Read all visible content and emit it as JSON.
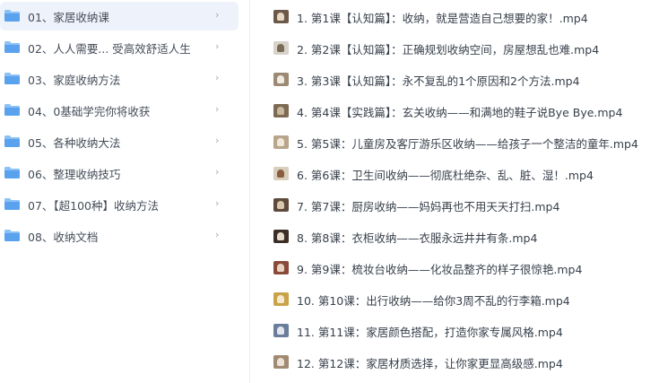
{
  "folders": [
    {
      "label": "01、家居收纳课",
      "active": true
    },
    {
      "label": "02、人人需要... 受高效舒适人生",
      "active": false
    },
    {
      "label": "03、家庭收纳方法",
      "active": false
    },
    {
      "label": "04、0基础学完你将收获",
      "active": false
    },
    {
      "label": "05、各种收纳大法",
      "active": false
    },
    {
      "label": "06、整理收纳技巧",
      "active": false
    },
    {
      "label": "07、【超100种】收纳方法",
      "active": false
    },
    {
      "label": "08、收纳文档",
      "active": false
    }
  ],
  "chevron_glyph": "›",
  "files": [
    {
      "label": "1. 第1课【认知篇】：收纳，就是营造自己想要的家！.mp4"
    },
    {
      "label": "2. 第2课【认知篇】：正确规划收纳空间，房屋想乱也难.mp4"
    },
    {
      "label": "3. 第3课【认知篇】：永不复乱的1个原因和2个方法.mp4"
    },
    {
      "label": "4. 第4课【实践篇】：玄关收纳——和满地的鞋子说Bye Bye.mp4"
    },
    {
      "label": "5. 第5课：儿童房及客厅游乐区收纳——给孩子一个整洁的童年.mp4"
    },
    {
      "label": "6. 第6课：卫生间收纳——彻底杜绝杂、乱、脏、湿！.mp4"
    },
    {
      "label": "7. 第7课：厨房收纳——妈妈再也不用天天打扫.mp4"
    },
    {
      "label": "8. 第8课：衣柜收纳——衣服永远井井有条.mp4"
    },
    {
      "label": "9. 第9课：梳妆台收纳——化妆品整齐的样子很惊艳.mp4"
    },
    {
      "label": "10. 第10课：出行收纳——给你3周不乱的行李箱.mp4"
    },
    {
      "label": "11. 第11课：家居颜色搭配，打造你家专属风格.mp4"
    },
    {
      "label": "12. 第12课：家居材质选择，让你家更显高级感.mp4"
    }
  ],
  "colors": {
    "active_bg": "#eef2fb",
    "folder_blue": "#5aa2ee",
    "folder_blue_light": "#8cc1f6"
  }
}
